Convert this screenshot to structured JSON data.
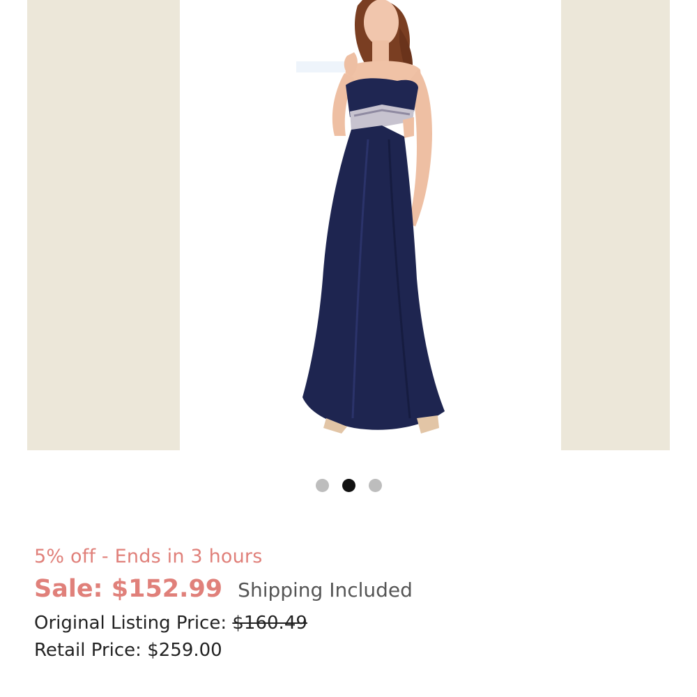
{
  "carousel": {
    "image_alt": "Navy strapless beaded gown",
    "dots": [
      {
        "active": false
      },
      {
        "active": true
      },
      {
        "active": false
      }
    ]
  },
  "colors": {
    "accent": "#e0807a",
    "background_panel": "#ece7d9",
    "dress": "#1e2550"
  },
  "pricing": {
    "promo": "5% off - Ends in 3 hours",
    "sale_label": "Sale:",
    "sale_price": "$152.99",
    "shipping": "Shipping Included",
    "original_label": "Original Listing Price:",
    "original_price": "$160.49",
    "retail_label": "Retail Price:",
    "retail_price": "$259.00"
  }
}
